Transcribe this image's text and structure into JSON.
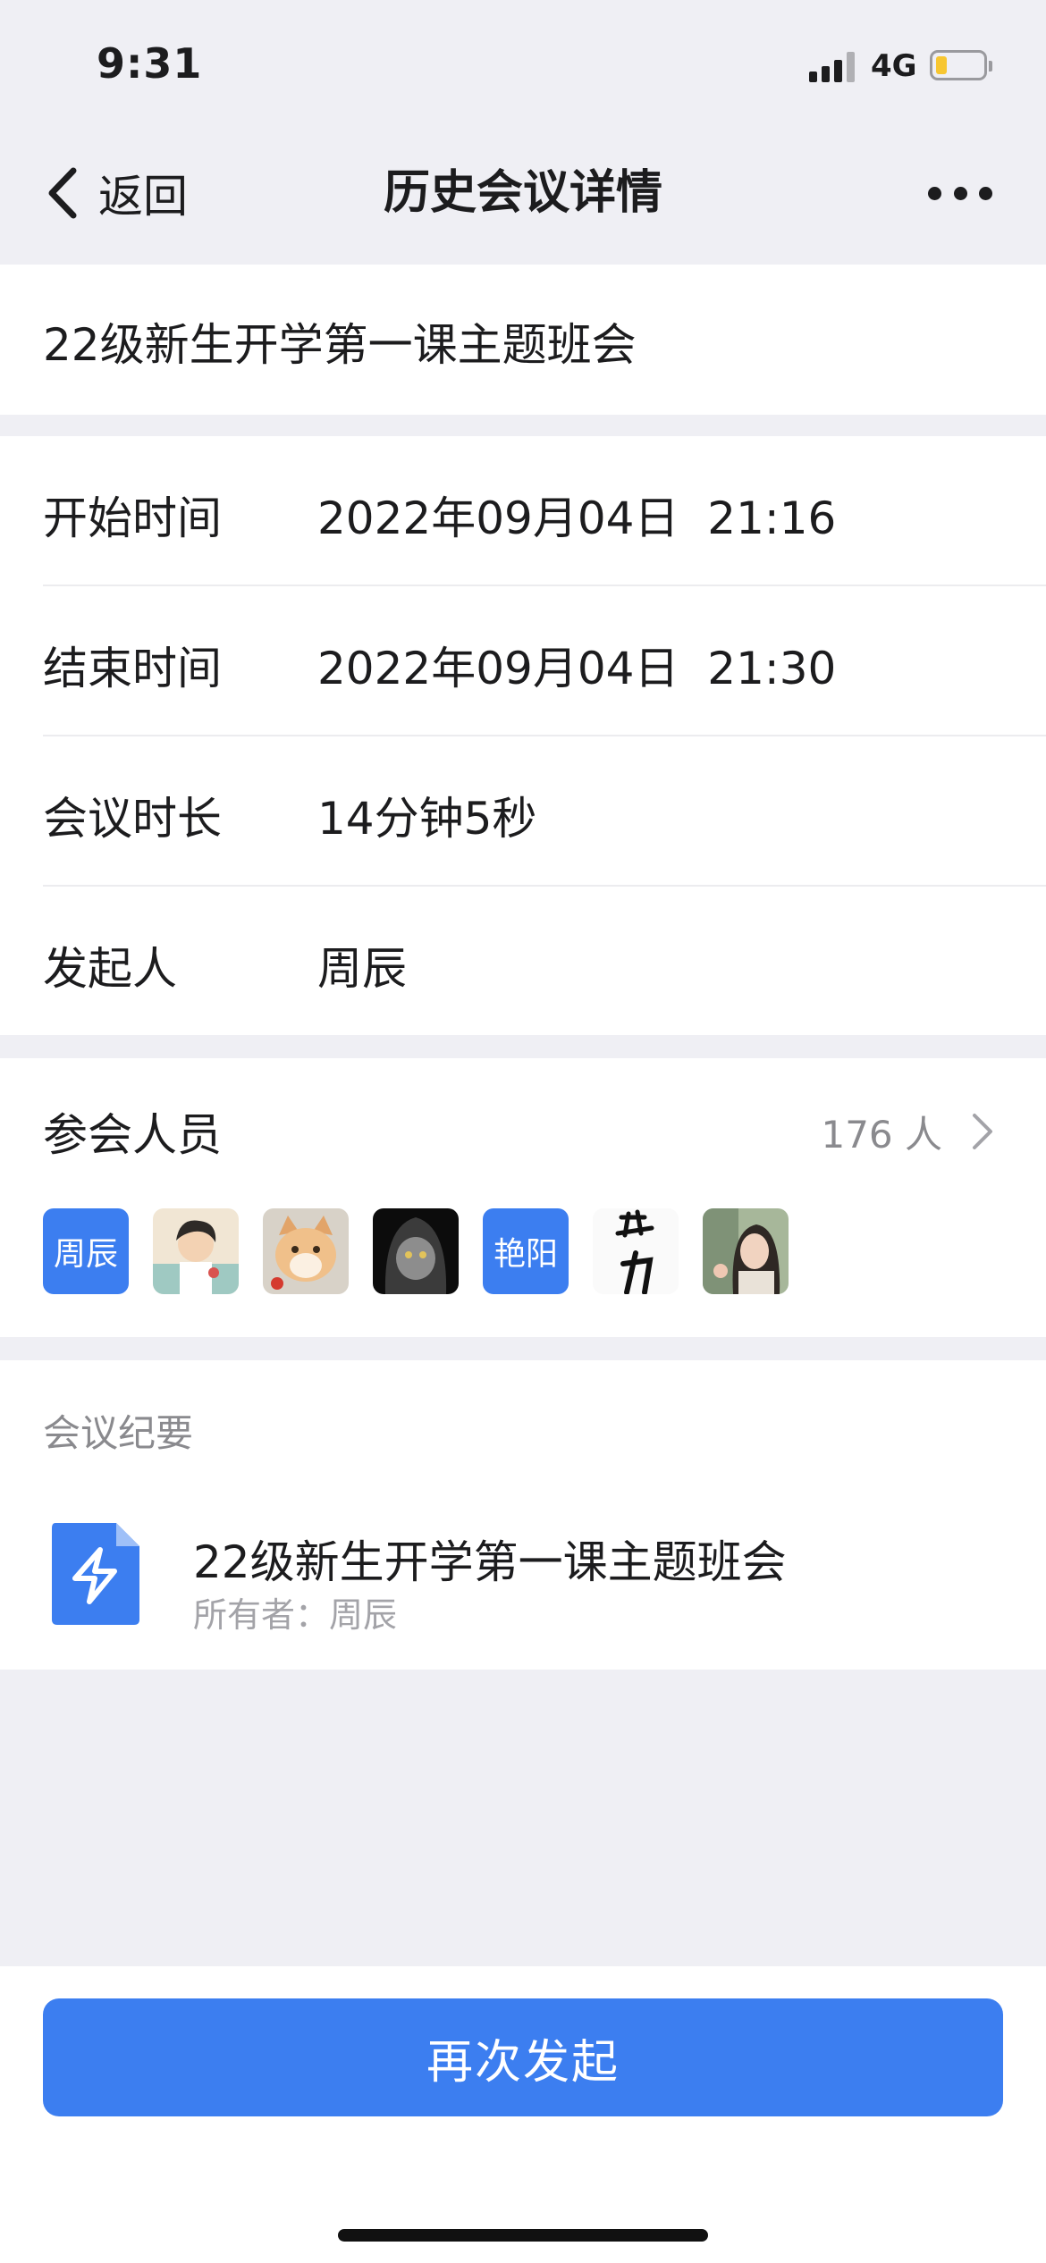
{
  "status_bar": {
    "time": "9:31",
    "network": "4G"
  },
  "nav": {
    "back_label": "返回",
    "title": "历史会议详情"
  },
  "meeting": {
    "title": "22级新生开学第一课主题班会"
  },
  "details": {
    "start_label": "开始时间",
    "start_value": "2022年09月04日  21:16",
    "end_label": "结束时间",
    "end_value": "2022年09月04日  21:30",
    "duration_label": "会议时长",
    "duration_value": "14分钟5秒",
    "host_label": "发起人",
    "host_value": "周辰"
  },
  "attendees": {
    "title": "参会人员",
    "count": "176 人",
    "avatars": [
      {
        "type": "text",
        "text": "周辰"
      },
      {
        "type": "image",
        "icon": "cartoon-boy-avatar"
      },
      {
        "type": "image",
        "icon": "orange-cat-avatar"
      },
      {
        "type": "image",
        "icon": "hooded-cat-avatar"
      },
      {
        "type": "text",
        "text": "艳阳"
      },
      {
        "type": "image",
        "icon": "calligraphy-avatar",
        "text": "努力"
      },
      {
        "type": "image",
        "icon": "girl-photo-avatar"
      }
    ]
  },
  "notes": {
    "title": "会议纪要",
    "doc_name": "22级新生开学第一课主题班会",
    "doc_owner": "所有者：周辰"
  },
  "footer": {
    "relaunch_label": "再次发起"
  },
  "colors": {
    "accent": "#3c7ef0",
    "background": "#efeff4",
    "battery": "#f7c631"
  }
}
